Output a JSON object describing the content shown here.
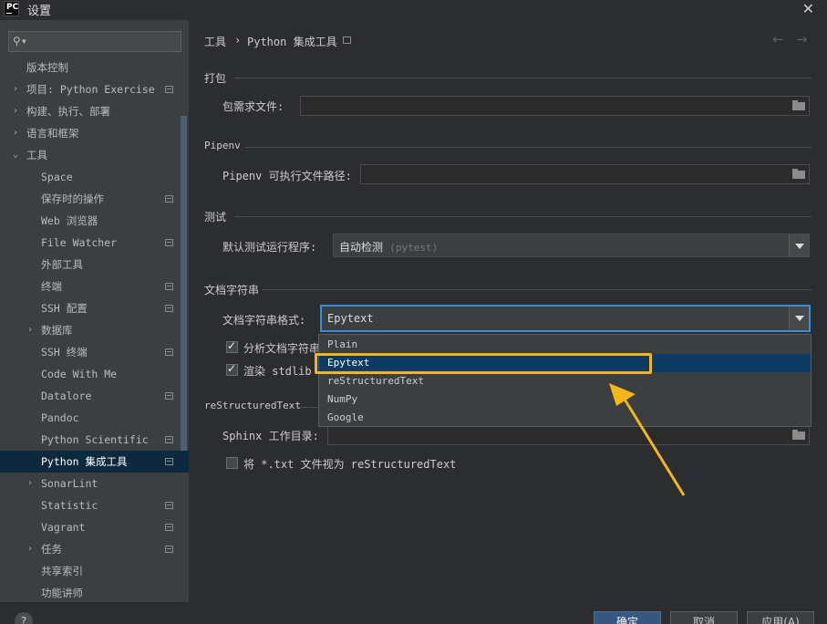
{
  "window": {
    "title": "设置",
    "app_icon_text": "PC"
  },
  "sidebar": {
    "search": {
      "placeholder": "",
      "value": ""
    },
    "items": [
      {
        "label": "版本控制",
        "level": 0,
        "arrow": "",
        "proj": false,
        "top": 0
      },
      {
        "label": "项目: Python Exercise",
        "level": 0,
        "arrow": "›",
        "proj": true
      },
      {
        "label": "构建、执行、部署",
        "level": 0,
        "arrow": "›",
        "proj": false
      },
      {
        "label": "语言和框架",
        "level": 0,
        "arrow": "›",
        "proj": false
      },
      {
        "label": "工具",
        "level": 0,
        "arrow": "⌄",
        "proj": false
      },
      {
        "label": "Space",
        "level": 1,
        "arrow": "",
        "proj": false
      },
      {
        "label": "保存时的操作",
        "level": 1,
        "arrow": "",
        "proj": true
      },
      {
        "label": "Web 浏览器",
        "level": 1,
        "arrow": "",
        "proj": false
      },
      {
        "label": "File Watcher",
        "level": 1,
        "arrow": "",
        "proj": true
      },
      {
        "label": "外部工具",
        "level": 1,
        "arrow": "",
        "proj": false
      },
      {
        "label": "终端",
        "level": 1,
        "arrow": "",
        "proj": true
      },
      {
        "label": "SSH 配置",
        "level": 1,
        "arrow": "",
        "proj": true
      },
      {
        "label": "数据库",
        "level": 1,
        "arrow": "›",
        "proj": false
      },
      {
        "label": "SSH 终端",
        "level": 1,
        "arrow": "",
        "proj": true
      },
      {
        "label": "Code With Me",
        "level": 1,
        "arrow": "",
        "proj": false
      },
      {
        "label": "Datalore",
        "level": 1,
        "arrow": "",
        "proj": true
      },
      {
        "label": "Pandoc",
        "level": 1,
        "arrow": "",
        "proj": false
      },
      {
        "label": "Python Scientific",
        "level": 1,
        "arrow": "",
        "proj": true
      },
      {
        "label": "Python 集成工具",
        "level": 1,
        "arrow": "",
        "proj": true,
        "selected": true
      },
      {
        "label": "SonarLint",
        "level": 1,
        "arrow": "›",
        "proj": false
      },
      {
        "label": "Statistic",
        "level": 1,
        "arrow": "",
        "proj": true
      },
      {
        "label": "Vagrant",
        "level": 1,
        "arrow": "",
        "proj": true
      },
      {
        "label": "任务",
        "level": 1,
        "arrow": "›",
        "proj": true
      },
      {
        "label": "共享索引",
        "level": 1,
        "arrow": "",
        "proj": false
      },
      {
        "label": "功能讲师",
        "level": 1,
        "arrow": "",
        "proj": false
      }
    ]
  },
  "breadcrumb": {
    "root": "工具",
    "separator": "›",
    "current": "Python 集成工具"
  },
  "sections": {
    "packaging": {
      "title": "打包",
      "req_label": "包需求文件:",
      "req_value": ""
    },
    "pipenv": {
      "title": "Pipenv",
      "path_label": "Pipenv 可执行文件路径:",
      "path_value": ""
    },
    "testing": {
      "title": "测试",
      "runner_label": "默认测试运行程序:",
      "runner_value": "自动检测",
      "runner_hint": "(pytest)"
    },
    "docstrings": {
      "title": "文档字符串",
      "format_label": "文档字符串格式:",
      "format_value": "Epytext",
      "analyze_label": "分析文档字符串",
      "render_label": "渲染 stdlib 的",
      "options": [
        "Plain",
        "Epytext",
        "reStructuredText",
        "NumPy",
        "Google"
      ],
      "selected_option": "Epytext"
    },
    "rest": {
      "title": "reStructuredText",
      "sphinx_label": "Sphinx 工作目录:",
      "sphinx_value": "",
      "txt_label": "将 *.txt 文件视为 reStructuredText"
    }
  },
  "footer": {
    "help": "?",
    "ok": "确定",
    "cancel": "取消",
    "apply": "应用(A)"
  },
  "colors": {
    "accent": "#3d8bd6",
    "selection": "#0d3b63",
    "highlight": "#f5b51c"
  }
}
